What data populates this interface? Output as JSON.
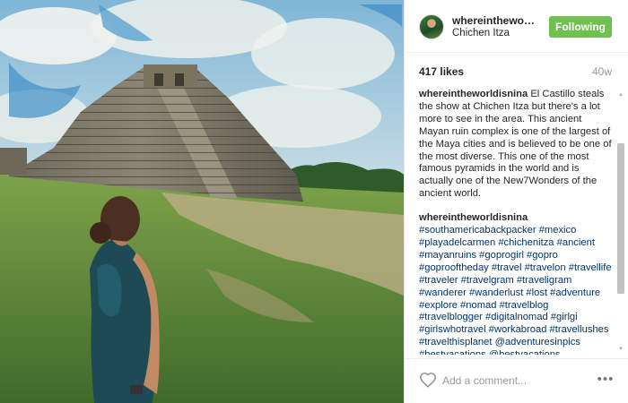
{
  "post": {
    "username": "whereintheworldisnina",
    "location": "Chichen Itza",
    "follow_label": "Following",
    "likes": "417 likes",
    "time_ago": "40w",
    "caption_user": "whereintheworldisnina",
    "caption_text": "El Castillo steals the show at Chichen Itza but there's a lot more to see in the area. This ancient Mayan ruin complex is one of the largest of the Maya cities and is believed to be one of the most diverse. This one of the most famous pyramids in the world and is actually one of the New7Wonders of the ancient world.",
    "hashtag_user": "whereintheworldisnina",
    "hashtags": [
      "#southamericabackpacker",
      "#mexico",
      "#playadelcarmen",
      "#chichenitza",
      "#ancient",
      "#mayanruins",
      "#goprogirl",
      "#gopro",
      "#goprooftheday",
      "#travel",
      "#travelon",
      "#travellife",
      "#traveler",
      "#travelgram",
      "#traveligram",
      "#wanderer",
      "#wanderlust",
      "#lost",
      "#adventure",
      "#explore",
      "#nomad",
      "#travelblog",
      "#travelblogger",
      "#digitalnomad",
      "#girlgi",
      "#girlswhotravel",
      "#workabroad",
      "#travellushes",
      "#travelthisplanet",
      "@adventuresinpics",
      "#bestvacations",
      "@bestvacations"
    ]
  },
  "footer": {
    "comment_placeholder": "Add a comment...",
    "more_label": "•••"
  },
  "icons": {
    "like": "heart-icon",
    "more": "more-options-icon"
  },
  "colors": {
    "follow_button": "#70c050",
    "hashtag": "#003569"
  }
}
